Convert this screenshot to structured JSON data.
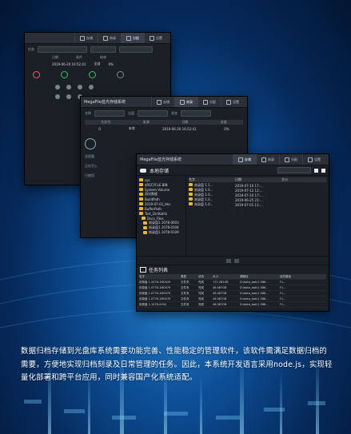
{
  "app": {
    "title": "MegaFile蓝光存储系统",
    "tabs": [
      {
        "label": "存储"
      },
      {
        "label": "刻录"
      },
      {
        "label": "分配"
      },
      {
        "label": "设置"
      }
    ]
  },
  "win1": {
    "row1_label": "任务",
    "row2": [
      "日期",
      "条件",
      "结束"
    ],
    "row3": [
      "2019-06-20 16:52:41",
      "全部",
      "0%"
    ]
  },
  "win2": {
    "fields": [
      "名称",
      "光盘",
      "状态"
    ],
    "headers": [
      "任务号",
      "来源",
      "日期",
      "进度"
    ],
    "row": [
      "0",
      "本地",
      "2019-06-20 16:52:41",
      "0%"
    ],
    "side_labels": [
      "总容量",
      "正在写入",
      "已使用"
    ]
  },
  "win3": {
    "storage_title": "本地存储",
    "tree": [
      "sys",
      "$RECYCLE.BIN",
      "System Volume",
      "测试数据",
      "BuildPath",
      "2019-07-01_bks",
      "BufferPath",
      "Test_Dir/Kotlin",
      "Docs_Files",
      "刻录盘1.1078-0003",
      "刻录盘1.1078-0104",
      "刻录盘1.1078-0109"
    ],
    "list_headers": [
      "名字",
      "日期",
      "大小"
    ],
    "list_rows": [
      [
        "刻录盘 1.1...",
        "2019-07-10 17:...",
        ""
      ],
      [
        "刻录盘 1.0...",
        "2019-07-12 12:...",
        ""
      ],
      [
        "刻录盘 1.0...",
        "2019-07-10 17:...",
        ""
      ],
      [
        "刻录盘 1.0...",
        "2019-06-25 21:...",
        ""
      ],
      [
        "刻录盘 1.0...",
        "2019-07-01 11:...",
        ""
      ]
    ],
    "task_title": "任务列表",
    "task_headers": [
      "名字",
      "类型",
      "状态",
      "大小",
      "源路径",
      "目的路径"
    ],
    "task_rows": [
      [
        "刻录盘 1.2578-1M0029",
        "文件夹",
        "完成",
        "171.281GB",
        "D:\\data_bak\\1.586...",
        "F:\\..."
      ],
      [
        "刻录盘 1.0778-1M0079",
        "文件夹",
        "完成",
        "46.087GB",
        "D:\\data_bak\\1.586...",
        "F:\\..."
      ],
      [
        "刻录盘 1.0778-1M0079",
        "文件夹",
        "完成",
        "46.087GB",
        "D:\\data_bak\\1.586...",
        "F:\\..."
      ],
      [
        "刻录盘 1.0778-1M0079",
        "文件夹",
        "完成",
        "46.087GB",
        "D:\\data_bak\\1.586...",
        "F:\\..."
      ],
      [
        "刻录盘 1.1078-0004",
        "文件夹",
        "完成",
        "46.087GB",
        "D:\\data_bak\\1.586...",
        "F:\\..."
      ]
    ]
  },
  "caption": "数据归档存储到光盘库系统需要功能完善、性能稳定的管理软件，该软件需满足数据归档的需要，方便地实现归档刻录及日常管理的任务。因此，本系统开发语言采用node.js，实现轻量化部署和跨平台应用，同时兼容国产化系统适配。"
}
